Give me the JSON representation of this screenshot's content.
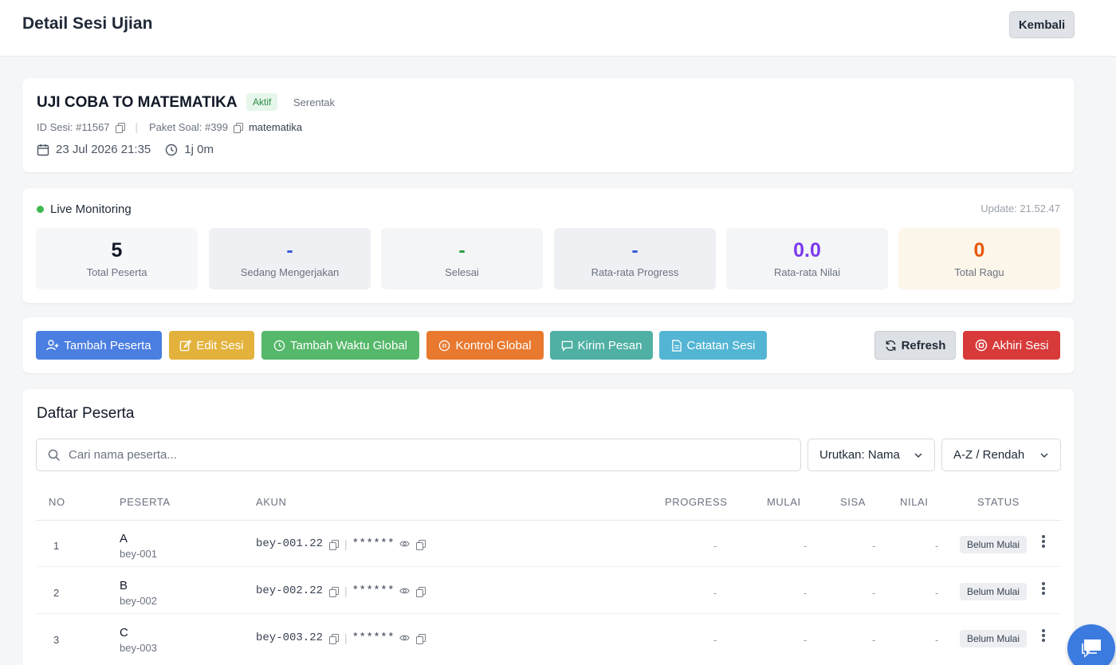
{
  "header": {
    "title": "Detail Sesi Ujian",
    "back_label": "Kembali"
  },
  "session": {
    "name": "UJI COBA TO MATEMATIKA",
    "status": "Aktif",
    "mode": "Serentak",
    "id_label": "ID Sesi: #11567",
    "package_label": "Paket Soal: #399",
    "package_name": "matematika",
    "date": "23 Jul 2026 21:35",
    "duration": "1j 0m"
  },
  "monitoring": {
    "title": "Live Monitoring",
    "update": "Update: 21.52.47",
    "stats": [
      {
        "value": "5",
        "label": "Total Peserta",
        "color": "#111827",
        "bg": "#f6f7f9"
      },
      {
        "value": "-",
        "label": "Sedang Mengerjakan",
        "color": "#3b5bdb",
        "bg": "#eef0f3"
      },
      {
        "value": "-",
        "label": "Selesai",
        "color": "#2f9e44",
        "bg": "#f3f5f7"
      },
      {
        "value": "-",
        "label": "Rata-rata Progress",
        "color": "#3b5bdb",
        "bg": "#eef0f3"
      },
      {
        "value": "0.0",
        "label": "Rata-rata Nilai",
        "color": "#7c3aed",
        "bg": "#f3f5f7"
      },
      {
        "value": "0",
        "label": "Total Ragu",
        "color": "#e8590c",
        "bg": "#fdf6ea"
      }
    ]
  },
  "actions": {
    "add_participant": "Tambah Peserta",
    "edit_session": "Edit Sesi",
    "add_time": "Tambah Waktu Global",
    "global_control": "Kontrol Global",
    "send_message": "Kirim Pesan",
    "session_notes": "Catatan Sesi",
    "refresh": "Refresh",
    "end_session": "Akhiri Sesi",
    "colors": {
      "blue": "#4a7ee0",
      "yellow": "#e3b23c",
      "green": "#55b86a",
      "orange": "#e8792f",
      "teal": "#4fb0a3",
      "cyan": "#53b5d3",
      "gray": "#dde0e4",
      "red": "#d83a3a"
    }
  },
  "participants": {
    "title": "Daftar Peserta",
    "search_placeholder": "Cari nama peserta...",
    "sort_by": "Urutkan: Nama",
    "sort_order": "A-Z / Rendah",
    "columns": [
      "NO",
      "PESERTA",
      "AKUN",
      "PROGRESS",
      "MULAI",
      "SISA",
      "NILAI",
      "STATUS"
    ],
    "rows": [
      {
        "no": "1",
        "name": "A",
        "username": "bey-001",
        "account": "bey-001.22",
        "password": "******",
        "progress": "-",
        "start": "-",
        "remaining": "-",
        "score": "-",
        "status": "Belum Mulai"
      },
      {
        "no": "2",
        "name": "B",
        "username": "bey-002",
        "account": "bey-002.22",
        "password": "******",
        "progress": "-",
        "start": "-",
        "remaining": "-",
        "score": "-",
        "status": "Belum Mulai"
      },
      {
        "no": "3",
        "name": "C",
        "username": "bey-003",
        "account": "bey-003.22",
        "password": "******",
        "progress": "-",
        "start": "-",
        "remaining": "-",
        "score": "-",
        "status": "Belum Mulai"
      }
    ]
  }
}
